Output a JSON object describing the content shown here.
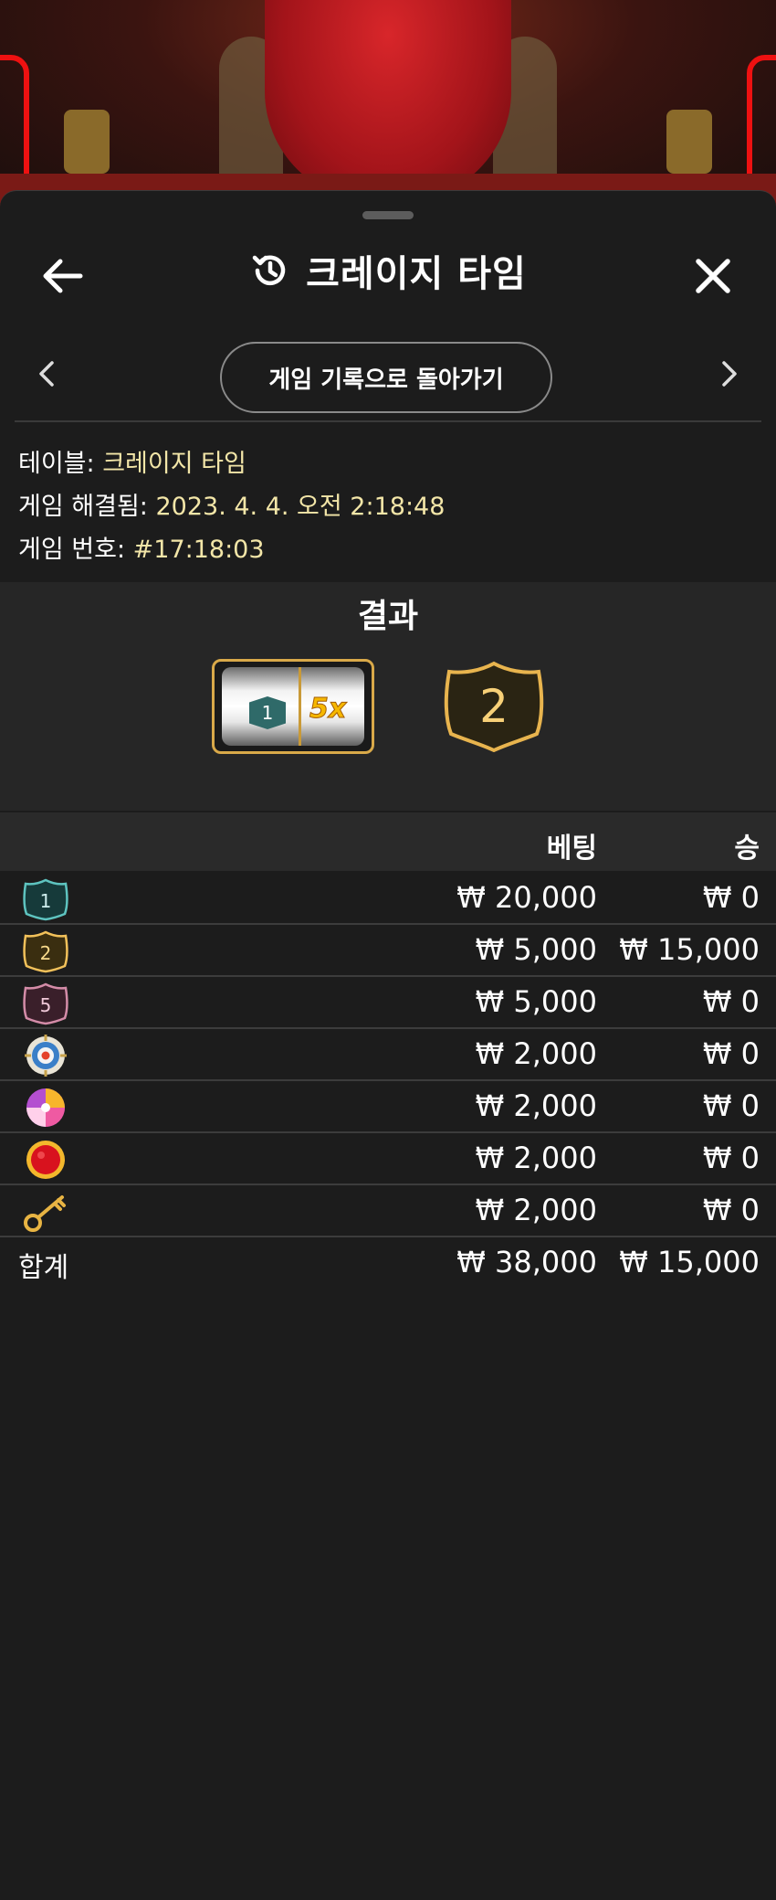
{
  "header": {
    "title": "크레이지 타임"
  },
  "nav": {
    "history_button": "게임 기록으로 돌아가기"
  },
  "details": {
    "table_label": "테이블:",
    "table_value": "크레이지 타임",
    "resolved_label": "게임 해결됨:",
    "resolved_value": "2023. 4. 4. 오전 2:18:48",
    "game_no_label": "게임 번호:",
    "game_no_value": "#17:18:03"
  },
  "result": {
    "title": "결과",
    "slot_segment": "1",
    "slot_multiplier": "5x",
    "wheel_result": "2"
  },
  "bets_table": {
    "col_bet": "베팅",
    "col_win": "승",
    "rows": [
      {
        "icon": "number-1-badge-icon",
        "bet": "₩ 20,000",
        "win": "₩ 0"
      },
      {
        "icon": "number-2-badge-icon",
        "bet": "₩ 5,000",
        "win": "₩ 15,000"
      },
      {
        "icon": "number-5-badge-icon",
        "bet": "₩ 5,000",
        "win": "₩ 0"
      },
      {
        "icon": "coin-flip-target-icon",
        "bet": "₩ 2,000",
        "win": "₩ 0"
      },
      {
        "icon": "pachinko-candy-icon",
        "bet": "₩ 2,000",
        "win": "₩ 0"
      },
      {
        "icon": "crazy-time-red-dot-icon",
        "bet": "₩ 2,000",
        "win": "₩ 0"
      },
      {
        "icon": "cash-hunt-key-icon",
        "bet": "₩ 2,000",
        "win": "₩ 0"
      }
    ],
    "badge_labels": [
      "1",
      "2",
      "5"
    ],
    "total_label": "합계",
    "total_bet": "₩ 38,000",
    "total_win": "₩ 15,000"
  },
  "colors": {
    "badge_1": "#2f6a69",
    "badge_2": "#f2c15a",
    "badge_5": "#d48ca8",
    "value_text": "#f3e6a8",
    "accent_gold": "#d9a949"
  }
}
